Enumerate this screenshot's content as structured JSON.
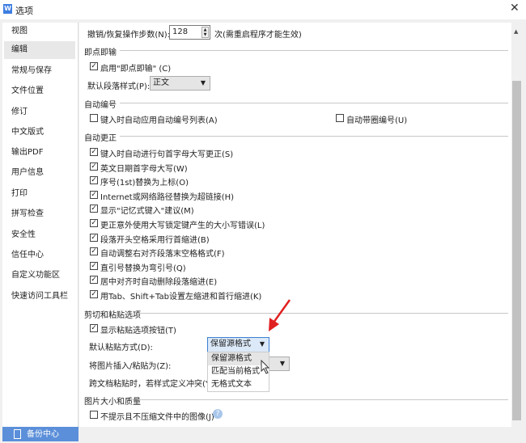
{
  "window": {
    "title": "选项",
    "logo": "W",
    "close": "✕"
  },
  "sidebar": {
    "items": [
      "视图",
      "编辑",
      "常规与保存",
      "文件位置",
      "修订",
      "中文版式",
      "输出PDF",
      "用户信息",
      "打印",
      "拼写检查",
      "安全性",
      "信任中心",
      "自定义功能区",
      "快速访问工具栏"
    ],
    "selected": "编辑",
    "backup": "备份中心"
  },
  "undo": {
    "label": "撤销/恢复操作步数(N):",
    "value": "128",
    "note": "次(需重启程序才能生效)"
  },
  "sections": {
    "instant": {
      "title": "即点即输",
      "enable": "启用\"即点即输\" (C)",
      "style_label": "默认段落样式(P):",
      "style_value": "正文"
    },
    "numbering": {
      "title": "自动编号",
      "auto_list": "键入时自动应用自动编号列表(A)",
      "circle": "自动带圈编号(U)"
    },
    "autocorrect": {
      "title": "自动更正",
      "items": [
        "键入时自动进行句首字母大写更正(S)",
        "英文日期首字母大写(W)",
        "序号(1st)替换为上标(O)",
        "Internet或网络路径替换为超链接(H)",
        "显示\"记忆式键入\"建议(M)",
        "更正意外使用大写锁定键产生的大小写错误(L)",
        "段落开头空格采用行首缩进(B)",
        "自动调整右对齐段落末空格格式(F)",
        "直引号替换为弯引号(Q)",
        "居中对齐时自动删除段落缩进(E)",
        "用Tab、Shift+Tab设置左缩进和首行缩进(K)"
      ]
    },
    "paste": {
      "title": "剪切和粘贴选项",
      "show_button": "显示粘贴选项按钮(T)",
      "default_label": "默认粘贴方式(D):",
      "default_value": "保留源格式",
      "image_label": "将图片插入/粘贴为(Z):",
      "conflict_label": "跨文档粘贴时，若样式定义冲突(Y):",
      "options": [
        "保留源格式",
        "匹配当前格式",
        "无格式文本"
      ]
    },
    "image": {
      "title": "图片大小和质量",
      "no_compress": "不提示且不压缩文件中的图像(J)",
      "help": "?"
    }
  },
  "colors": {
    "accent": "#5b8fd9",
    "arrow": "#e02020"
  }
}
